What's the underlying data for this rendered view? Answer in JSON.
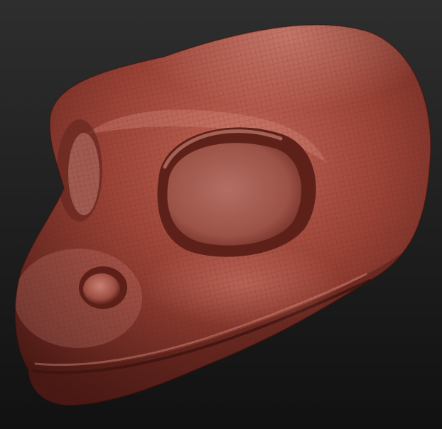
{
  "viewport": {
    "background_top": "#2e2e2e",
    "background_bottom": "#111111"
  },
  "model": {
    "subject": "reptile-head-sculpt",
    "material_base": "#8a3a30",
    "material_light": "#c3685a",
    "material_highlight": "#e6a293",
    "material_shadow": "#4a1914",
    "wireframe_visible": true,
    "wireframe_color": "#5a1f18"
  }
}
